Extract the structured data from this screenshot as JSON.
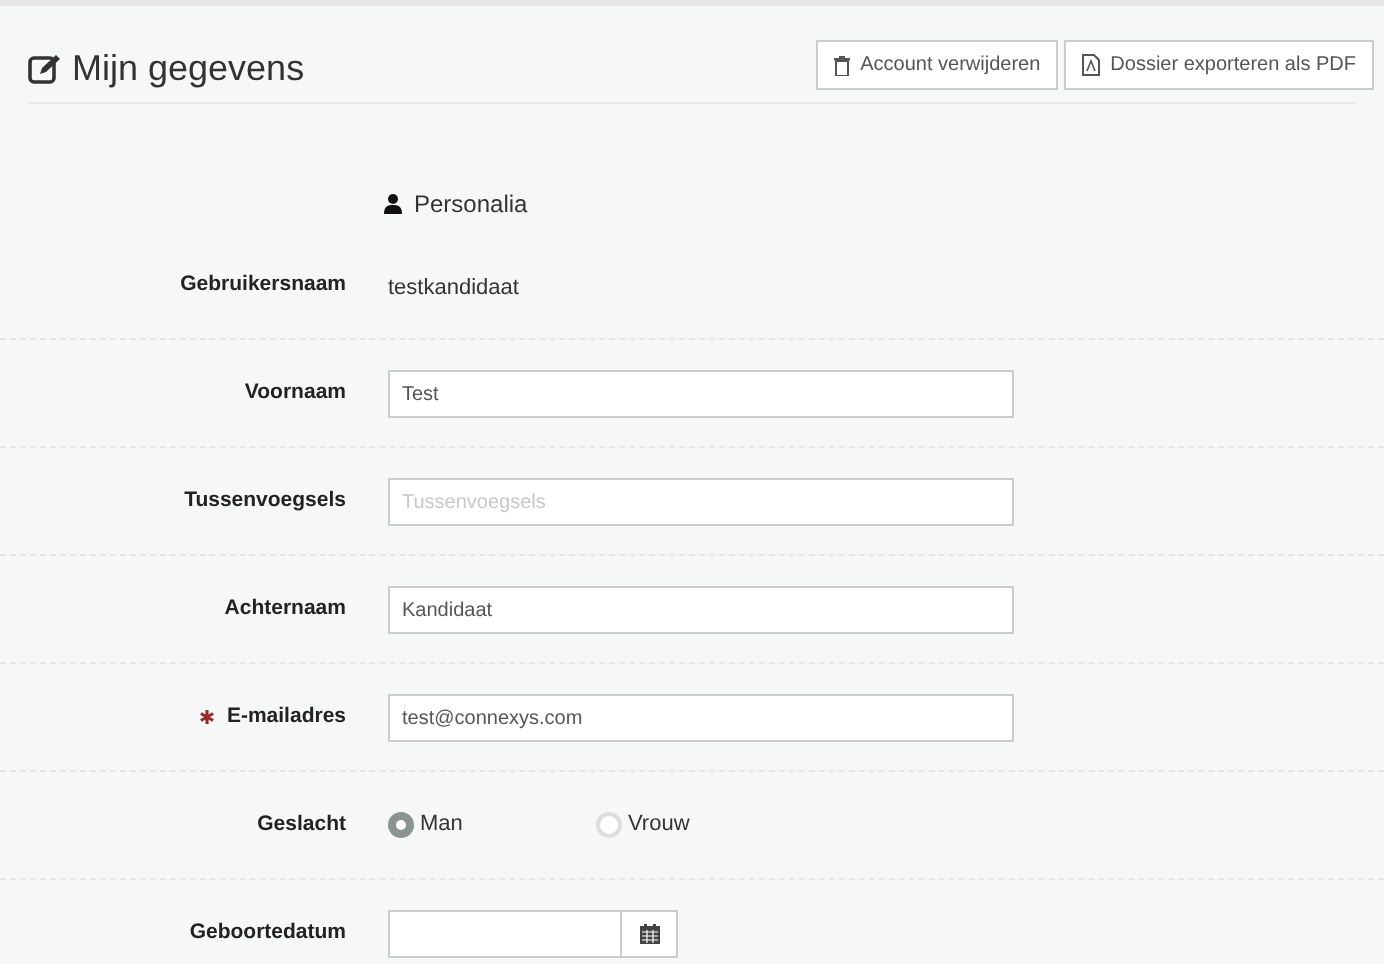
{
  "header": {
    "title": "Mijn gegevens",
    "buttons": [
      {
        "kind": "delete",
        "label": "Account verwijderen"
      },
      {
        "kind": "pdf",
        "label": "Dossier exporteren als PDF"
      }
    ]
  },
  "section": {
    "title": "Personalia"
  },
  "rows": [
    {
      "kind": "text",
      "label": "Gebruikersnaam",
      "value": "testkandidaat"
    },
    {
      "kind": "input",
      "label": "Voornaam",
      "value": "Test"
    },
    {
      "kind": "input",
      "label": "Tussenvoegsels",
      "placeholder": "Tussenvoegsels"
    },
    {
      "kind": "input",
      "label": "Achternaam",
      "value": "Kandidaat"
    },
    {
      "kind": "input",
      "label": "E-mailadres",
      "required": true,
      "value": "test@connexys.com"
    },
    {
      "kind": "radio",
      "label": "Geslacht",
      "options": [
        {
          "label": "Man",
          "selected": true
        },
        {
          "label": "Vrouw",
          "selected": false
        }
      ]
    },
    {
      "kind": "date",
      "label": "Geboortedatum"
    }
  ]
}
